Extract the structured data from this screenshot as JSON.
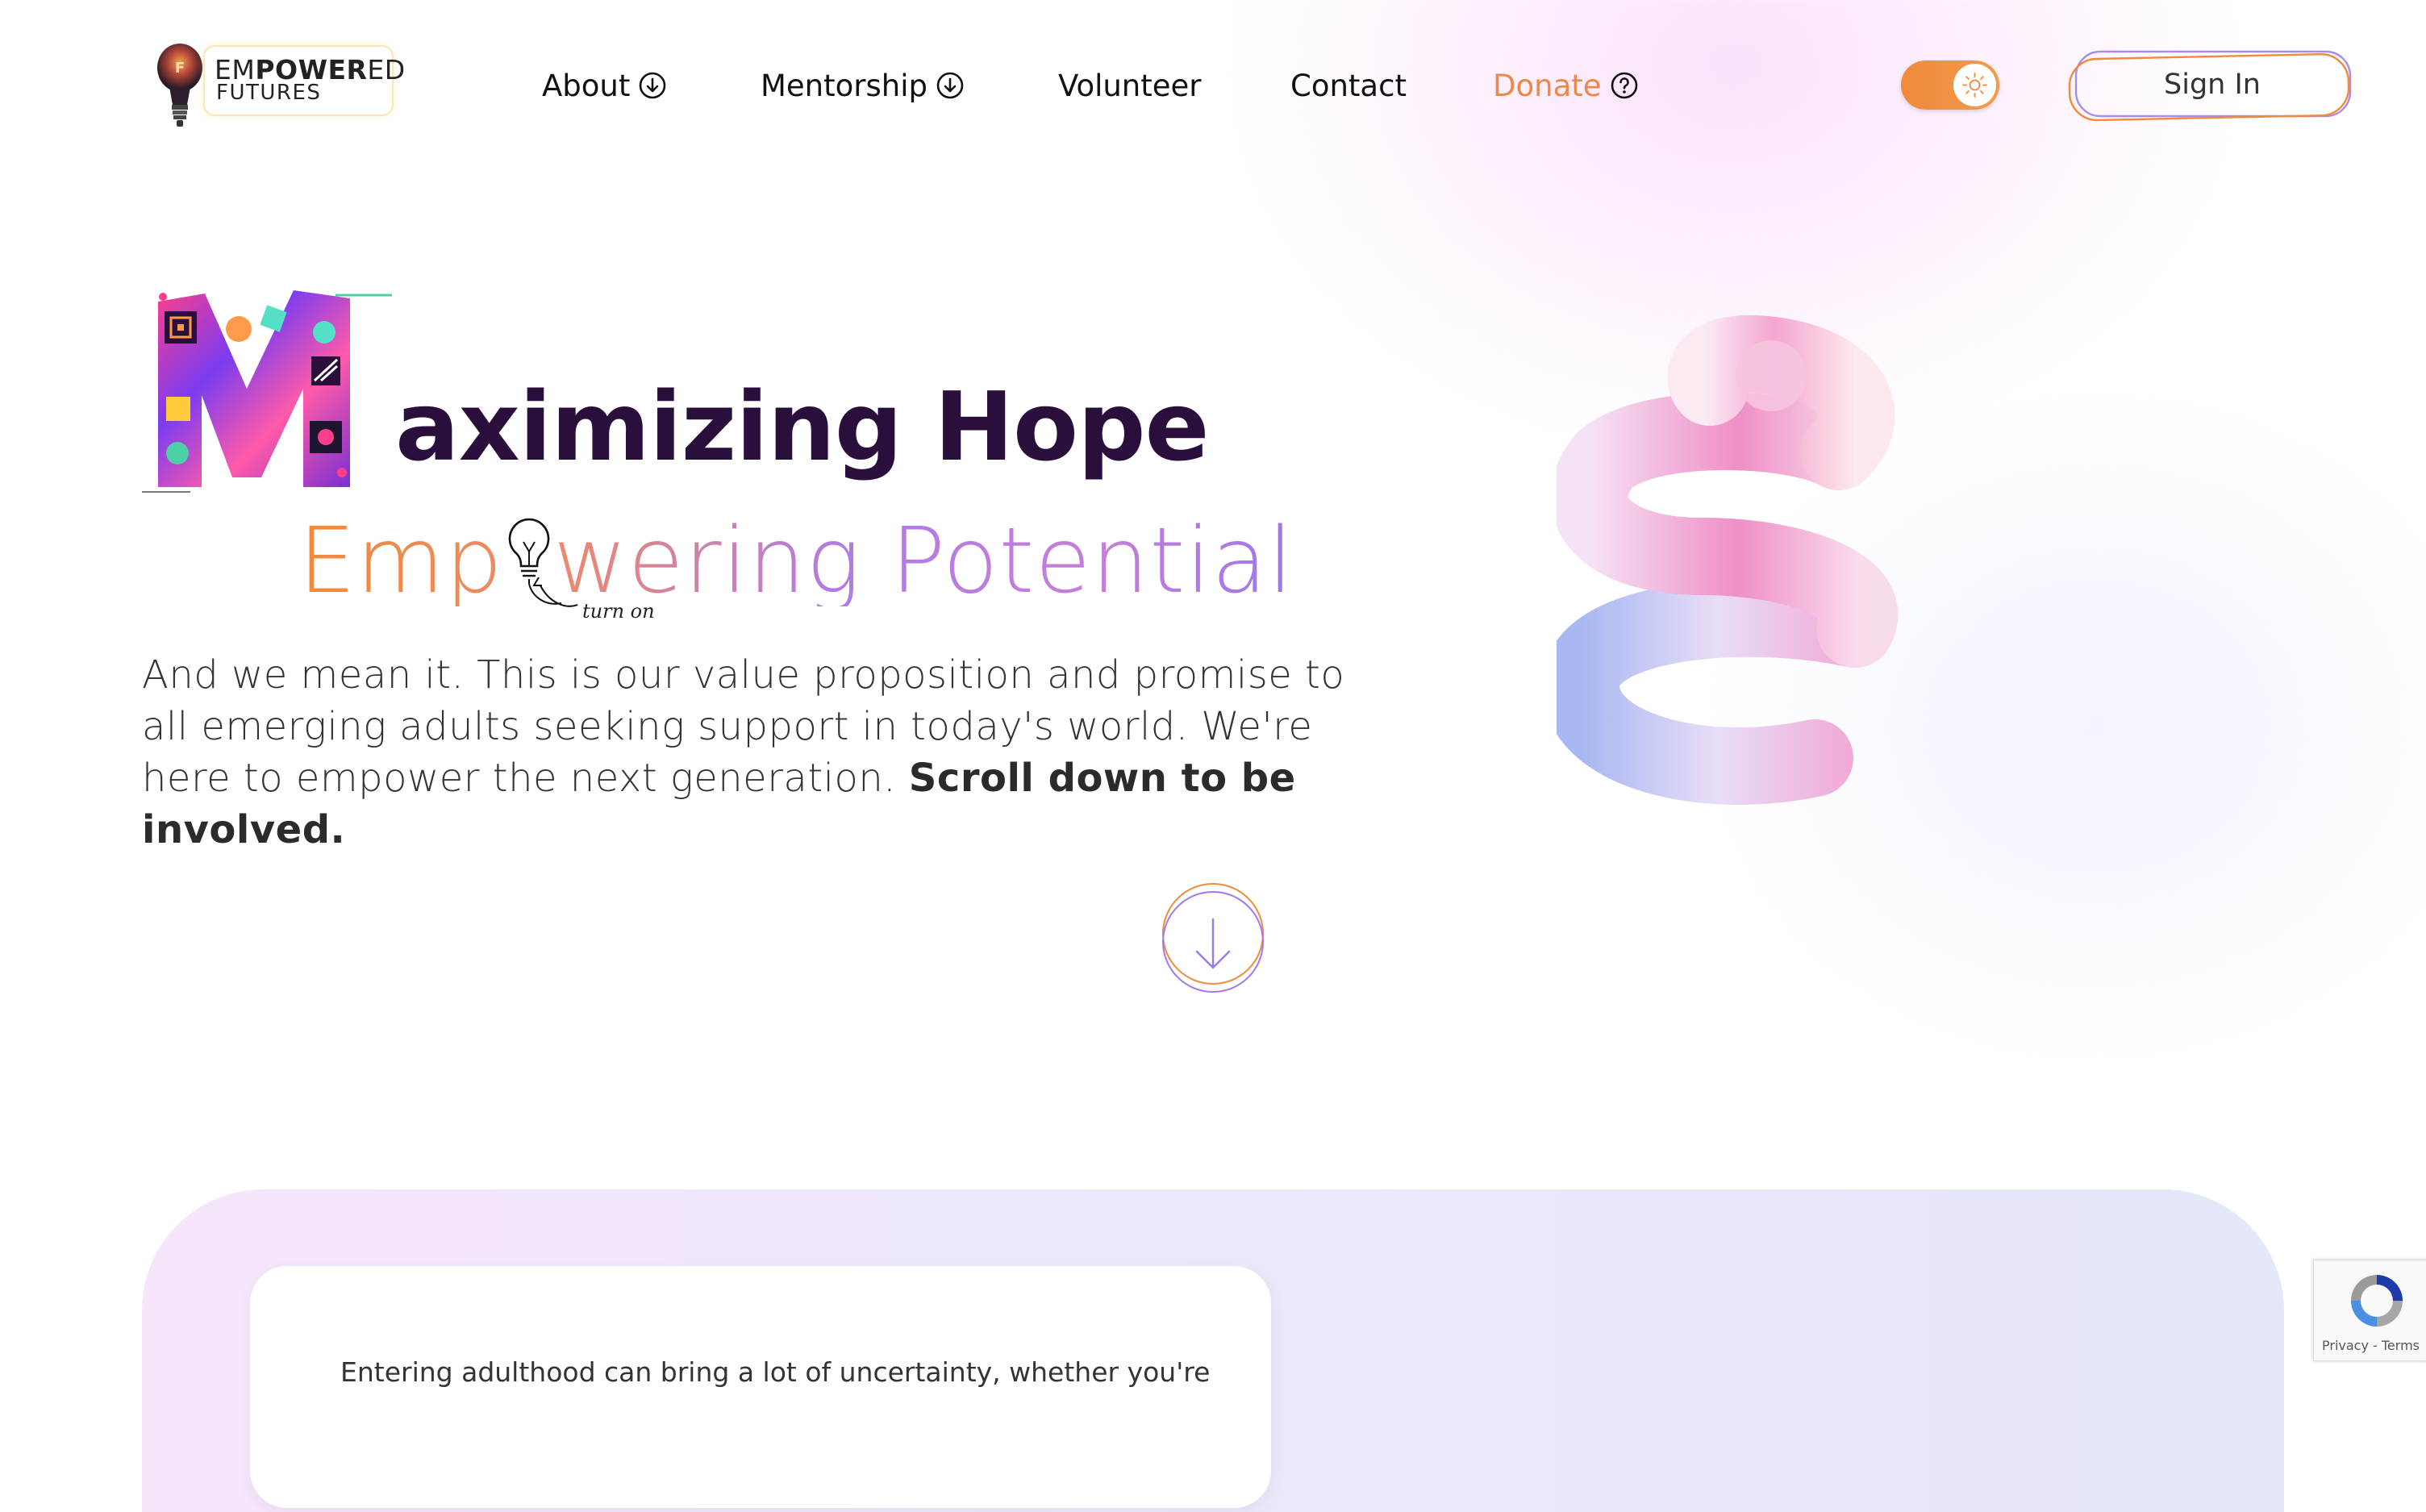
{
  "header": {
    "logo": {
      "line1_light": "EM",
      "line1_bold": "POWER",
      "line1_end": "ED",
      "line2": "FUTURES"
    },
    "nav": [
      {
        "label": "About",
        "icon": "arrow-down-circle-icon"
      },
      {
        "label": "Mentorship",
        "icon": "arrow-down-circle-icon"
      },
      {
        "label": "Volunteer"
      },
      {
        "label": "Contact"
      },
      {
        "label": "Donate",
        "icon": "question-circle-icon",
        "color": "#e9894b"
      }
    ],
    "theme_toggle": {
      "state": "light",
      "icon": "sun-icon",
      "color": "#f08a3c"
    },
    "sign_in_label": "Sign In"
  },
  "hero": {
    "title_rest": "aximizing Hope",
    "subtitle_a": "Emp",
    "subtitle_b": "wering Potential",
    "doodle_caption": "turn on",
    "body_text": "And we mean it. This is our value proposition and promise to all emerging adults seeking support in today's world. We're here to empower the next generation. ",
    "body_bold": "Scroll down to be involved.",
    "title_color": "#2a0f3c"
  },
  "scroll_button": {
    "icon": "arrow-down-icon"
  },
  "section": {
    "card_text": "Entering adulthood can bring a lot of uncertainty, whether you're"
  },
  "recaptcha": {
    "links": "Privacy - Terms"
  }
}
